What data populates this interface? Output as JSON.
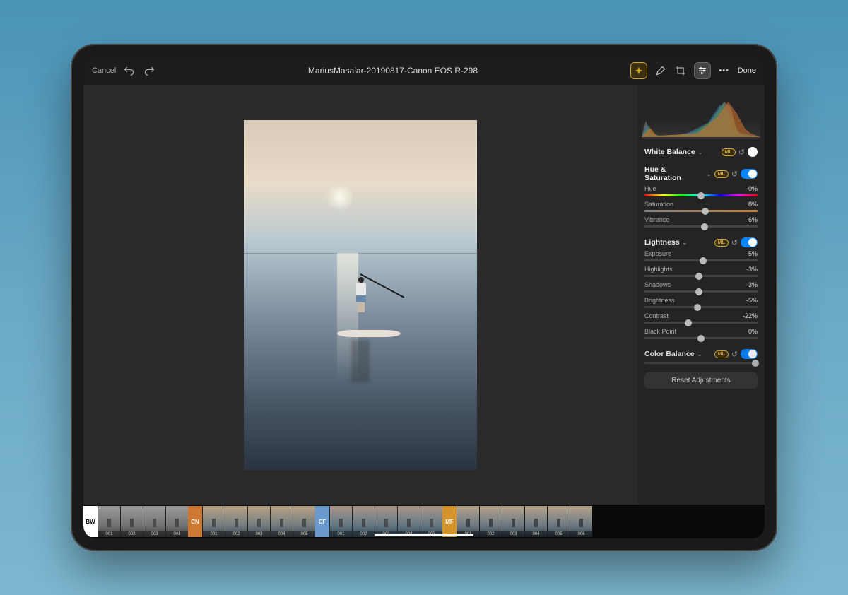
{
  "toolbar": {
    "cancel": "Cancel",
    "title": "MariusMasalar-20190817-Canon EOS R-298",
    "done": "Done"
  },
  "panel": {
    "white_balance": {
      "title": "White Balance",
      "on": false
    },
    "hue_sat": {
      "title": "Hue & Saturation",
      "on": true,
      "sliders": [
        {
          "label": "Hue",
          "value": "-0%",
          "pos": 50,
          "kind": "hue"
        },
        {
          "label": "Saturation",
          "value": "8%",
          "pos": 54,
          "kind": "sat"
        },
        {
          "label": "Vibrance",
          "value": "6%",
          "pos": 53,
          "kind": "plain"
        }
      ]
    },
    "lightness": {
      "title": "Lightness",
      "on": true,
      "sliders": [
        {
          "label": "Exposure",
          "value": "5%",
          "pos": 52
        },
        {
          "label": "Highlights",
          "value": "-3%",
          "pos": 48
        },
        {
          "label": "Shadows",
          "value": "-3%",
          "pos": 48
        },
        {
          "label": "Brightness",
          "value": "-5%",
          "pos": 47
        },
        {
          "label": "Contrast",
          "value": "-22%",
          "pos": 39
        },
        {
          "label": "Black Point",
          "value": "0%",
          "pos": 50
        }
      ]
    },
    "color_balance": {
      "title": "Color Balance",
      "on": true
    },
    "reset": "Reset Adjustments"
  },
  "filmstrip": {
    "groups": [
      {
        "badge": "BW",
        "class": "bw",
        "thumbs": [
          "001",
          "002",
          "003",
          "004"
        ]
      },
      {
        "badge": "CN",
        "class": "cn",
        "thumbs": [
          "001",
          "002",
          "003",
          "004",
          "005"
        ]
      },
      {
        "badge": "CF",
        "class": "cf",
        "thumbs": [
          "001",
          "002",
          "003",
          "004",
          "005"
        ]
      },
      {
        "badge": "MF",
        "class": "mf",
        "thumbs": [
          "001",
          "002",
          "003",
          "004",
          "005",
          "006"
        ]
      }
    ]
  }
}
